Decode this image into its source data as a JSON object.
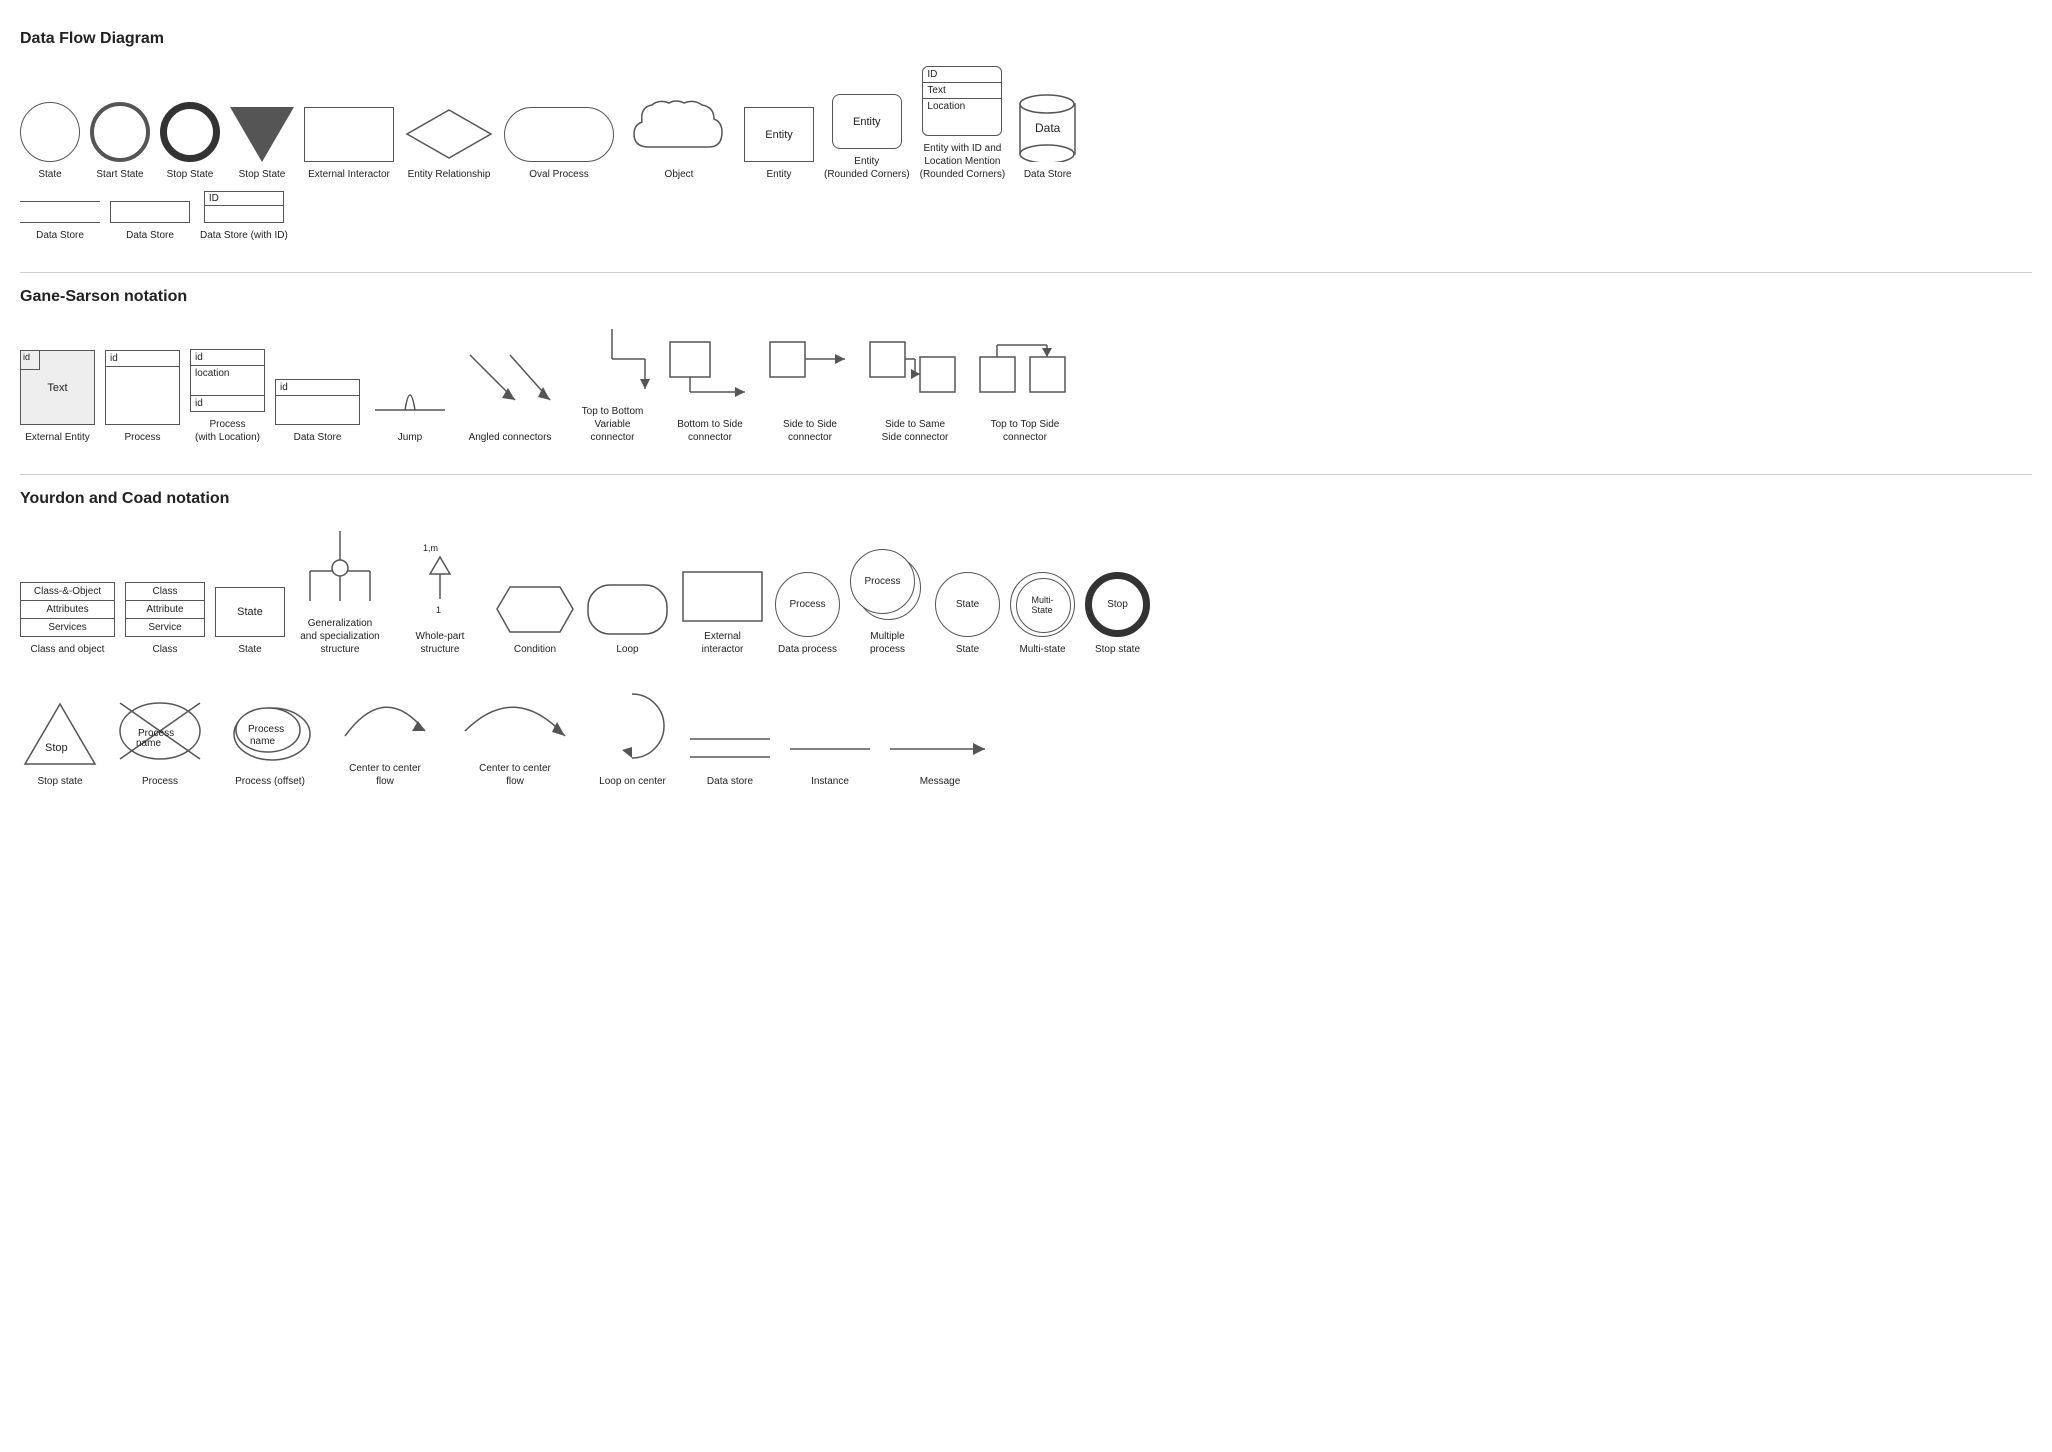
{
  "dfd": {
    "title": "Data Flow Diagram",
    "shapes": [
      {
        "id": "state",
        "label": "State"
      },
      {
        "id": "start-state",
        "label": "Start State"
      },
      {
        "id": "stop-state-double",
        "label": "Stop State"
      },
      {
        "id": "stop-state-tri",
        "label": "Stop State"
      },
      {
        "id": "external-interactor",
        "label": "External Interactor"
      },
      {
        "id": "entity-relationship",
        "label": "Entity Relationship"
      },
      {
        "id": "oval-process",
        "label": "Oval Process"
      },
      {
        "id": "object",
        "label": "Object"
      },
      {
        "id": "entity",
        "label": "Entity"
      },
      {
        "id": "entity-rounded",
        "label": "Entity\n(Rounded Corners)"
      },
      {
        "id": "entity-with-id",
        "label": "Entity with ID and\nLocation Mention\n(Rounded Corners)"
      },
      {
        "id": "data-store-cyl",
        "label": "Data Store"
      }
    ],
    "data_stores": [
      {
        "id": "ds1",
        "label": "Data Store"
      },
      {
        "id": "ds2",
        "label": "Data Store"
      },
      {
        "id": "ds3",
        "label": "Data Store (with ID)"
      }
    ],
    "entity_text": {
      "id": "ID",
      "text": "Text",
      "location": "Location"
    },
    "entity_label": "Entity",
    "ds_id_label": "ID"
  },
  "gs": {
    "title": "Gane-Sarson notation",
    "shapes": [
      {
        "id": "external-entity",
        "label": "External Entity"
      },
      {
        "id": "process",
        "label": "Process"
      },
      {
        "id": "process-with-loc",
        "label": "Process\n(with Location)"
      },
      {
        "id": "data-store",
        "label": "Data Store"
      },
      {
        "id": "jump",
        "label": "Jump"
      },
      {
        "id": "angled-connectors",
        "label": "Angled connectors"
      },
      {
        "id": "top-bottom-var",
        "label": "Top to Bottom\nVariable\nconnector"
      },
      {
        "id": "bottom-side",
        "label": "Bottom to Side\nconnector"
      },
      {
        "id": "side-side",
        "label": "Side to Side\nconnector"
      },
      {
        "id": "side-same-side",
        "label": "Side to Same\nSide connector"
      },
      {
        "id": "top-top-side",
        "label": "Top to Top Side\nconnector"
      }
    ],
    "id_label": "id",
    "location_label": "location"
  },
  "yc": {
    "title": "Yourdon and Coad notation",
    "row1": [
      {
        "id": "class-and-object",
        "label": "Class and object"
      },
      {
        "id": "class",
        "label": "Class"
      },
      {
        "id": "state",
        "label": "State"
      },
      {
        "id": "gen-spec",
        "label": "Generalization\nand specialization\nstructure"
      },
      {
        "id": "whole-part",
        "label": "Whole-part\nstructure"
      },
      {
        "id": "condition",
        "label": "Condition"
      },
      {
        "id": "loop",
        "label": "Loop"
      },
      {
        "id": "external-interactor",
        "label": "External\ninteractor"
      },
      {
        "id": "data-process",
        "label": "Data process"
      },
      {
        "id": "multiple-process",
        "label": "Multiple\nprocess"
      },
      {
        "id": "state-circle",
        "label": "State"
      },
      {
        "id": "multi-state",
        "label": "Multi-state"
      },
      {
        "id": "stop-state",
        "label": "Stop state"
      }
    ],
    "row2": [
      {
        "id": "stop-state-tri",
        "label": "Stop state"
      },
      {
        "id": "process-name",
        "label": "Process"
      },
      {
        "id": "process-offset",
        "label": "Process (offset)"
      },
      {
        "id": "center-flow1",
        "label": "Center to center\nflow"
      },
      {
        "id": "center-flow2",
        "label": "Center to center\nflow"
      },
      {
        "id": "loop-center",
        "label": "Loop on center"
      },
      {
        "id": "data-store-line",
        "label": "Data store"
      },
      {
        "id": "instance",
        "label": "Instance"
      },
      {
        "id": "message",
        "label": "Message"
      }
    ],
    "class_obj_rows": [
      "Class-&-Object",
      "Attributes",
      "Services"
    ],
    "class_rows": [
      "Class",
      "Attribute",
      "Service"
    ],
    "state_label": "State",
    "process_label": "Process",
    "state_circle_label": "State",
    "multi_state_label": "Multi-\nState",
    "stop_label": "Stop",
    "whole_part_labels": [
      "1,m",
      "1"
    ],
    "class_attr_service": "Class Attribute Service"
  }
}
